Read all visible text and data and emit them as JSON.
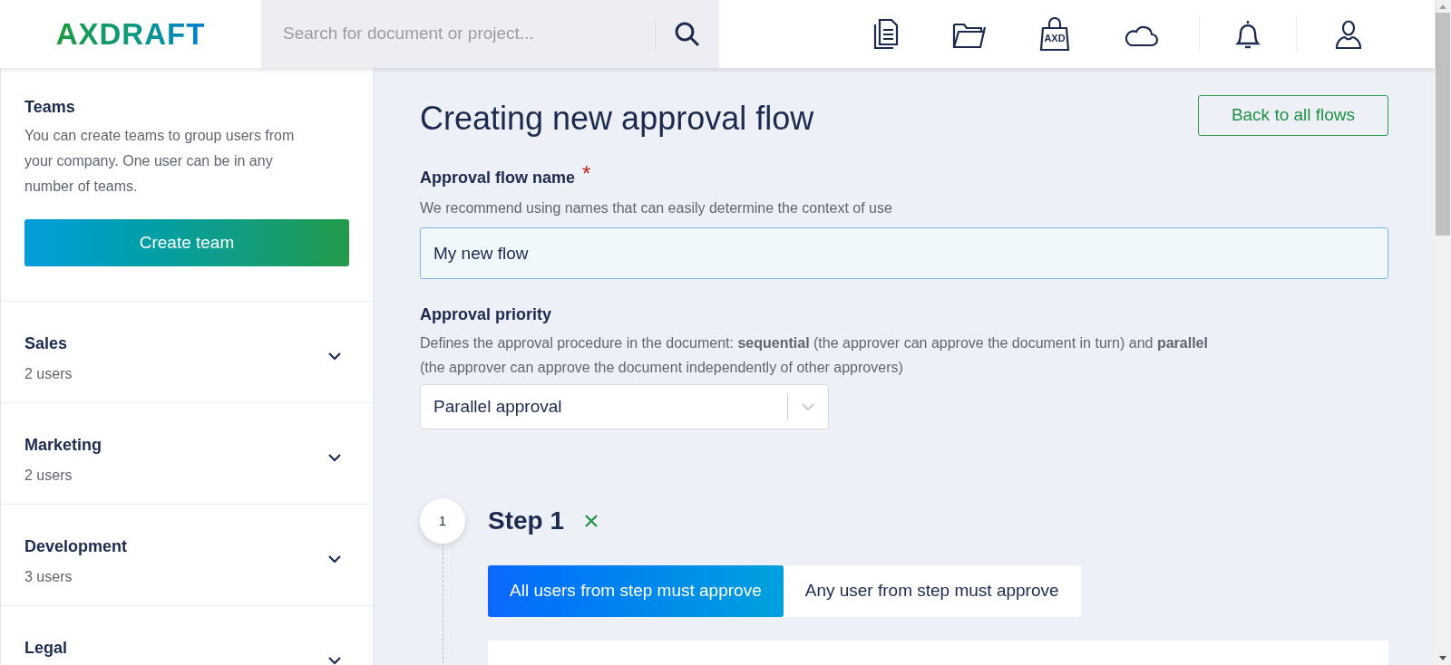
{
  "header": {
    "logo": "AXDRAFT",
    "search": {
      "placeholder": "Search for document or project..."
    },
    "store_badge": "AXD"
  },
  "sidebar": {
    "title": "Teams",
    "description": "You can create teams to group users from your company. One user can be in any number of teams.",
    "create_button": "Create team",
    "teams": [
      {
        "name": "Sales",
        "count": "2 users",
        "expanded": false
      },
      {
        "name": "Marketing",
        "count": "2 users",
        "expanded": false
      },
      {
        "name": "Development",
        "count": "3 users",
        "expanded": false
      },
      {
        "name": "Legal",
        "expanded": false
      }
    ]
  },
  "main": {
    "title": "Creating new approval flow",
    "back_button": "Back to all flows",
    "name_field": {
      "label": "Approval flow name",
      "required_mark": "*",
      "hint": "We recommend using names that can easily determine the context of use",
      "value": "My new flow"
    },
    "priority": {
      "label": "Approval priority",
      "hint": "Defines the approval procedure in the document: **sequential** (the approver can approve the document in turn) and **parallel** (the approver can approve the document independently of other approvers)",
      "value": "Parallel approval"
    },
    "steps": [
      {
        "number": "1",
        "title": "Step 1",
        "modes": [
          {
            "label": "All users from step must approve",
            "selected": true
          },
          {
            "label": "Any user from step must approve",
            "selected": false
          }
        ]
      }
    ]
  }
}
